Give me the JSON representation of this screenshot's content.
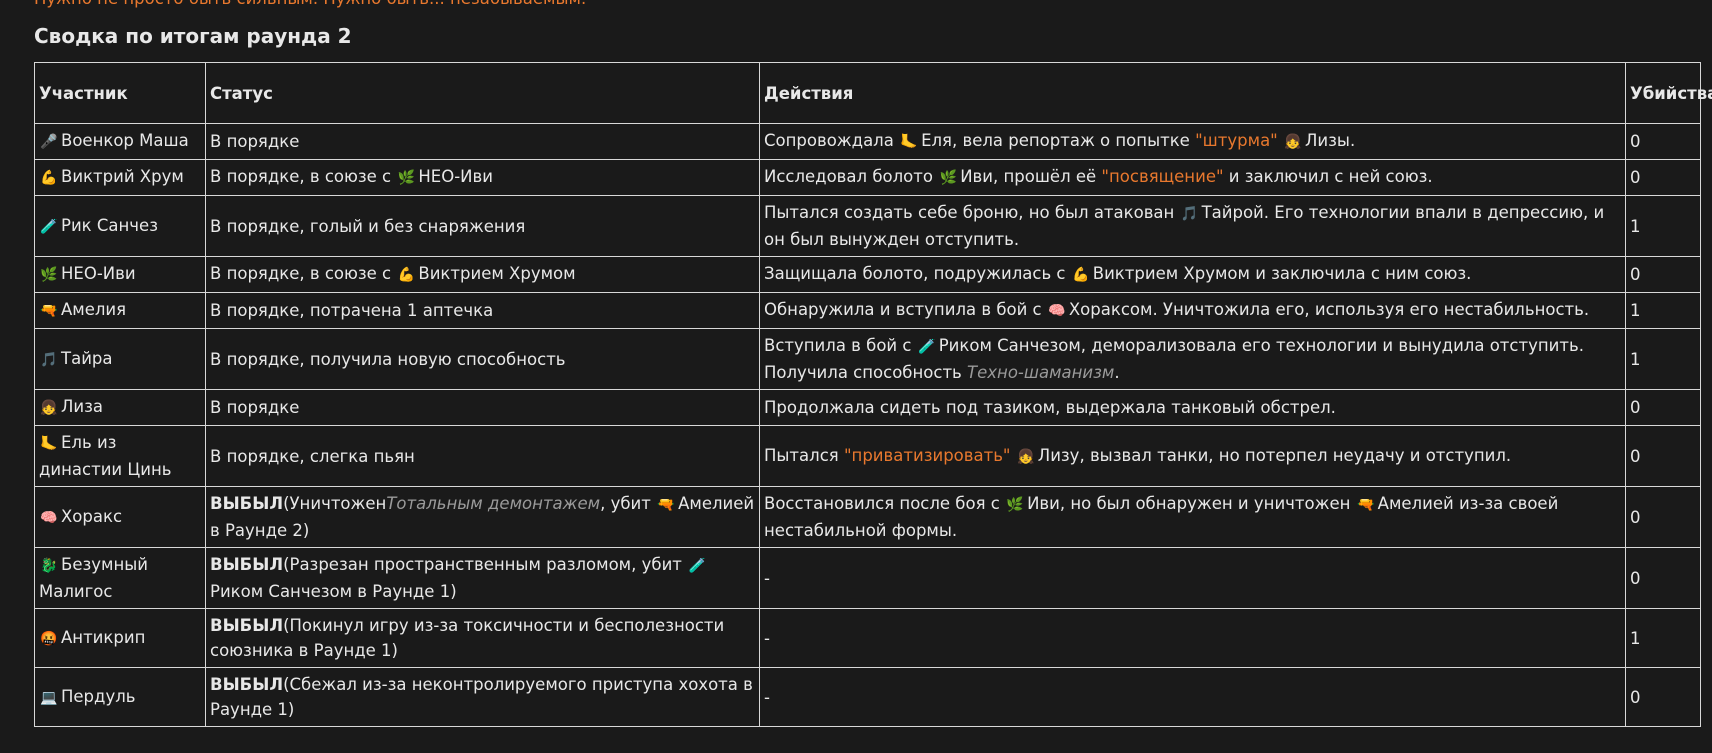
{
  "top_note": "Нужно не просто быть сильным. Нужно быть... незабываемым.",
  "title": "Сводка по итогам раунда 2",
  "headers": [
    "Участник",
    "Статус",
    "Действия",
    "Убийства"
  ],
  "rows": [
    {
      "participant": {
        "icon": "🎤",
        "icon_name": "microphone-icon",
        "name": "Военкор Маша"
      },
      "status": [
        {
          "t": "В порядке"
        }
      ],
      "actions": [
        {
          "t": "Сопровождала "
        },
        {
          "icon": "🦶",
          "icon_name": "foot-icon"
        },
        {
          "t": "Еля, вела репортаж о попытке "
        },
        {
          "t": "\"штурма\"",
          "c": "accent"
        },
        {
          "t": " "
        },
        {
          "icon": "👧",
          "icon_name": "girl-icon"
        },
        {
          "t": "Лизы."
        }
      ],
      "kills": "0"
    },
    {
      "participant": {
        "icon": "💪",
        "icon_name": "flexed-arm-icon",
        "name": "Виктрий Хрум"
      },
      "status": [
        {
          "t": "В порядке, в союзе с "
        },
        {
          "icon": "🌿",
          "icon_name": "herb-icon"
        },
        {
          "t": "НЕО-Иви"
        }
      ],
      "actions": [
        {
          "t": "Исследовал болото "
        },
        {
          "icon": "🌿",
          "icon_name": "herb-icon"
        },
        {
          "t": "Иви, прошёл её "
        },
        {
          "t": "\"посвящение\"",
          "c": "accent"
        },
        {
          "t": " и заключил с ней союз."
        }
      ],
      "kills": "0"
    },
    {
      "participant": {
        "icon": "🧪",
        "icon_name": "test-tube-icon",
        "name": "Рик Санчез"
      },
      "status": [
        {
          "t": "В порядке, голый и без снаряжения"
        }
      ],
      "actions": [
        {
          "t": "Пытался создать себе броню, но был атакован "
        },
        {
          "icon": "🎵",
          "icon_name": "music-note-icon"
        },
        {
          "t": "Тайрой. Его технологии впали в депрессию, и он был вынужден отступить."
        }
      ],
      "kills": "1"
    },
    {
      "participant": {
        "icon": "🌿",
        "icon_name": "herb-icon",
        "name": "НЕО-Иви"
      },
      "status": [
        {
          "t": "В порядке, в союзе с "
        },
        {
          "icon": "💪",
          "icon_name": "flexed-arm-icon"
        },
        {
          "t": "Виктрием Хрумом"
        }
      ],
      "actions": [
        {
          "t": "Защищала болото, подружилась с "
        },
        {
          "icon": "💪",
          "icon_name": "flexed-arm-icon"
        },
        {
          "t": "Виктрием Хрумом и заключила с ним союз."
        }
      ],
      "kills": "0"
    },
    {
      "participant": {
        "icon": "🔫",
        "icon_name": "pistol-icon",
        "name": "Амелия"
      },
      "status": [
        {
          "t": "В порядке, потрачена 1 аптечка"
        }
      ],
      "actions": [
        {
          "t": "Обнаружила и вступила в бой с "
        },
        {
          "icon": "🧠",
          "icon_name": "brain-icon"
        },
        {
          "t": "Хораксом. Уничтожила его, используя его нестабильность."
        }
      ],
      "kills": "1"
    },
    {
      "participant": {
        "icon": "🎵",
        "icon_name": "music-note-icon",
        "name": "Тайра"
      },
      "status": [
        {
          "t": "В порядке, получила новую способность"
        }
      ],
      "actions": [
        {
          "t": "Вступила в бой с "
        },
        {
          "icon": "🧪",
          "icon_name": "test-tube-icon"
        },
        {
          "t": "Риком Санчезом, деморализовала его технологии и вынудила отступить. Получила способность "
        },
        {
          "t": "Техно-шаманизм",
          "c": "dim"
        },
        {
          "t": "."
        }
      ],
      "kills": "1"
    },
    {
      "participant": {
        "icon": "👧",
        "icon_name": "girl-icon",
        "name": "Лиза"
      },
      "status": [
        {
          "t": "В порядке"
        }
      ],
      "actions": [
        {
          "t": "Продолжала сидеть под тазиком, выдержала танковый обстрел."
        }
      ],
      "kills": "0"
    },
    {
      "participant": {
        "icon": "🦶",
        "icon_name": "foot-icon",
        "name": "Ель из династии Цинь"
      },
      "status": [
        {
          "t": "В порядке, слегка пьян"
        }
      ],
      "actions": [
        {
          "t": "Пытался "
        },
        {
          "t": "\"приватизировать\"",
          "c": "accent"
        },
        {
          "t": " "
        },
        {
          "icon": "👧",
          "icon_name": "girl-icon"
        },
        {
          "t": "Лизу, вызвал танки, но потерпел неудачу и отступил."
        }
      ],
      "kills": "0"
    },
    {
      "participant": {
        "icon": "🧠",
        "icon_name": "brain-icon",
        "name": "Хоракс"
      },
      "status": [
        {
          "t": "ВЫБЫЛ",
          "c": "bold"
        },
        {
          "t": "(Уничтожен"
        },
        {
          "t": "Тотальным демонтажем",
          "c": "dim"
        },
        {
          "t": ", убит "
        },
        {
          "icon": "🔫",
          "icon_name": "pistol-icon"
        },
        {
          "t": "Амелией в Раунде 2)"
        }
      ],
      "actions": [
        {
          "t": "Восстановился после боя с "
        },
        {
          "icon": "🌿",
          "icon_name": "herb-icon"
        },
        {
          "t": "Иви, но был обнаружен и уничтожен "
        },
        {
          "icon": "🔫",
          "icon_name": "pistol-icon"
        },
        {
          "t": "Амелией из-за своей нестабильной формы."
        }
      ],
      "kills": "0"
    },
    {
      "participant": {
        "icon": "🐉",
        "icon_name": "dragon-icon",
        "name": "Безумный Малигос"
      },
      "status": [
        {
          "t": "ВЫБЫЛ",
          "c": "bold"
        },
        {
          "t": "(Разрезан пространственным разломом, убит "
        },
        {
          "icon": "🧪",
          "icon_name": "test-tube-icon"
        },
        {
          "t": "Риком Санчезом в Раунде 1)"
        }
      ],
      "actions": [
        {
          "t": "-"
        }
      ],
      "kills": "0"
    },
    {
      "participant": {
        "icon": "🤬",
        "icon_name": "angry-face-icon",
        "name": "Антикрип"
      },
      "status": [
        {
          "t": "ВЫБЫЛ",
          "c": "bold"
        },
        {
          "t": "(Покинул игру из-за токсичности и бесполезности союзника в Раунде 1)"
        }
      ],
      "actions": [
        {
          "t": "-"
        }
      ],
      "kills": "1"
    },
    {
      "participant": {
        "icon": "💻",
        "icon_name": "laptop-icon",
        "name": "Пердуль"
      },
      "status": [
        {
          "t": "ВЫБЫЛ",
          "c": "bold"
        },
        {
          "t": "(Сбежал из-за неконтролируемого приступа хохота в Раунде 1)"
        }
      ],
      "actions": [
        {
          "t": "-"
        }
      ],
      "kills": "0"
    }
  ]
}
